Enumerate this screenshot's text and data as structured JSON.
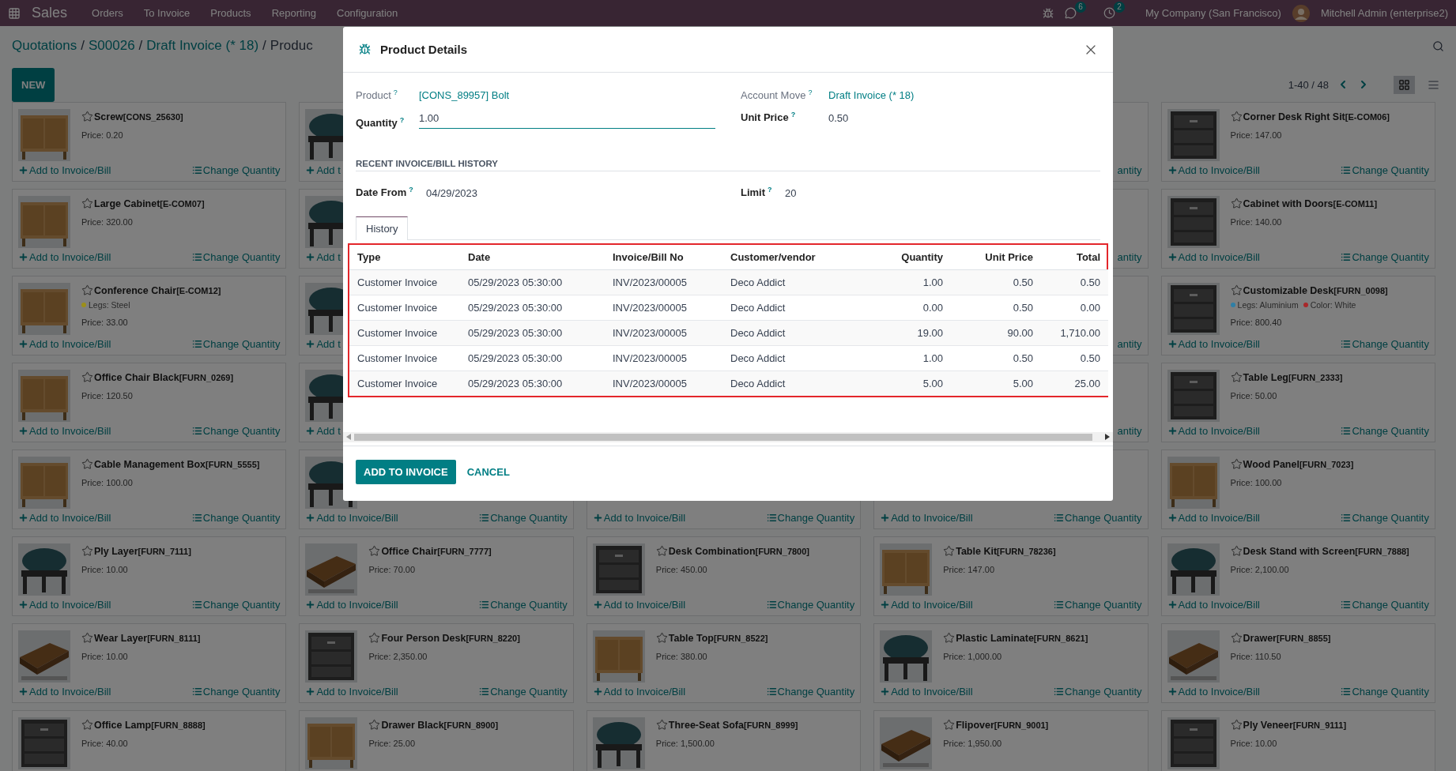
{
  "navbar": {
    "app": "Sales",
    "menu": [
      "Orders",
      "To Invoice",
      "Products",
      "Reporting",
      "Configuration"
    ],
    "messages_badge": "6",
    "activities_badge": "2",
    "company": "My Company (San Francisco)",
    "user": "Mitchell Admin (enterprise2)"
  },
  "breadcrumbs": [
    {
      "kind": "link",
      "text": "Quotations"
    },
    {
      "kind": "separator",
      "text": "/"
    },
    {
      "kind": "link",
      "text": "S00026"
    },
    {
      "kind": "separator",
      "text": "/"
    },
    {
      "kind": "link",
      "text": "Draft Invoice (* 18)"
    },
    {
      "kind": "separator",
      "text": "/"
    },
    {
      "kind": "current",
      "text": "Produc"
    }
  ],
  "new_button": "NEW",
  "pager": "1-40 / 48",
  "views": [
    {
      "kind": "kanban",
      "selected": true
    },
    {
      "kind": "list",
      "selected": false
    }
  ],
  "cards": [
    {
      "name": "Screw",
      "code": "[CONS_25630]",
      "price": "Price: 0.20",
      "image": {
        "kind": "picture"
      },
      "add": "Add to Invoice/Bill",
      "change": "Change Quantity"
    },
    {
      "image": {
        "kind": "picture"
      },
      "add": "Add t"
    },
    {
      "kind": "cut_right",
      "change": "antity"
    },
    {
      "name": "Corner Desk Right Sit",
      "code": "[E-COM06]",
      "price": "Price: 147.00",
      "image": {
        "kind": "picture"
      },
      "add": "Add to Invoice/Bill",
      "change": "Change Quantity"
    },
    {
      "name": "Large Cabinet",
      "code": "[E-COM07]",
      "price": "Price: 320.00",
      "image": {
        "kind": "picture"
      },
      "add": "Add to Invoice/Bill",
      "change": "Change Quantity"
    },
    {
      "image": {
        "kind": "picture"
      },
      "add": "Add t"
    },
    {
      "kind": "cut_right",
      "change": "antity"
    },
    {
      "name": "Cabinet with Doors",
      "code": "[E-COM11]",
      "price": "Price: 140.00",
      "image": {
        "kind": "picture"
      },
      "add": "Add to Invoice/Bill",
      "change": "Change Quantity"
    },
    {
      "name": "Conference Chair",
      "code": "[E-COM12]",
      "attributes": [
        {
          "text": "Legs: Steel",
          "color": "#9c8f1a"
        }
      ],
      "price": "Price: 33.00",
      "image": {
        "kind": "picture"
      },
      "add": "Add to Invoice/Bill",
      "change": "Change Quantity"
    },
    {
      "image": {
        "kind": "picture"
      },
      "add": "Add t"
    },
    {
      "kind": "cut_right",
      "change": "antity"
    },
    {
      "name": "Customizable Desk",
      "code": "[FURN_0098]",
      "attributes": [
        {
          "text": "Legs: Aluminium",
          "color": "#2f7fa6"
        },
        {
          "text": "Color: White",
          "color": "#a8282a"
        }
      ],
      "price": "Price: 800.40",
      "image": {
        "kind": "picture"
      },
      "add": "Add to Invoice/Bill",
      "change": "Change Quantity"
    },
    {
      "name": "Office Chair Black",
      "code": "[FURN_0269]",
      "price": "Price: 120.50",
      "image": {
        "kind": "picture"
      },
      "add": "Add to Invoice/Bill",
      "change": "Change Quantity"
    },
    {
      "image": {
        "kind": "picture"
      },
      "add": "Add t"
    },
    {
      "kind": "cut_right",
      "change": "antity"
    },
    {
      "name": "Table Leg",
      "code": "[FURN_2333]",
      "price": "Price: 50.00",
      "image": {
        "kind": "picture"
      },
      "add": "Add to Invoice/Bill",
      "change": "Change Quantity"
    },
    {
      "name": "Cable Management Box",
      "code": "[FURN_5555]",
      "price": "Price: 100.00",
      "image": {
        "kind": "picture"
      },
      "add": "Add to Invoice/Bill",
      "change": "Change Quantity"
    },
    {
      "image": {
        "kind": "picture"
      },
      "add": "Add to Invoice/Bill",
      "change": "Change Quantity"
    },
    {
      "add": "Add to Invoice/Bill",
      "change": "Change Quantity"
    },
    {
      "add": "Add to Invoice/Bill",
      "change": "Change Quantity"
    },
    {
      "name": "Wood Panel",
      "code": "[FURN_7023]",
      "price": "Price: 100.00",
      "image": {
        "kind": "picture"
      },
      "add": "Add to Invoice/Bill",
      "change": "Change Quantity"
    },
    {
      "name": "Ply Layer",
      "code": "[FURN_7111]",
      "price": "Price: 10.00",
      "image": {
        "kind": "picture"
      },
      "add": "Add to Invoice/Bill",
      "change": "Change Quantity"
    },
    {
      "name": "Office Chair",
      "code": "[FURN_7777]",
      "price": "Price: 70.00",
      "image": {
        "kind": "picture"
      },
      "add": "Add to Invoice/Bill",
      "change": "Change Quantity"
    },
    {
      "name": "Desk Combination",
      "code": "[FURN_7800]",
      "price": "Price: 450.00",
      "image": {
        "kind": "picture"
      },
      "add": "Add to Invoice/Bill",
      "change": "Change Quantity"
    },
    {
      "name": "Table Kit",
      "code": "[FURN_78236]",
      "price": "Price: 147.00",
      "image": {
        "kind": "picture"
      },
      "add": "Add to Invoice/Bill",
      "change": "Change Quantity"
    },
    {
      "name": "Desk Stand with Screen",
      "code": "[FURN_7888]",
      "price": "Price: 2,100.00",
      "image": {
        "kind": "picture"
      },
      "add": "Add to Invoice/Bill",
      "change": "Change Quantity"
    },
    {
      "name": "Wear Layer",
      "code": "[FURN_8111]",
      "price": "Price: 10.00",
      "image": {
        "kind": "picture"
      },
      "add": "Add to Invoice/Bill",
      "change": "Change Quantity"
    },
    {
      "name": "Four Person Desk",
      "code": "[FURN_8220]",
      "price": "Price: 2,350.00",
      "image": {
        "kind": "picture"
      },
      "add": "Add to Invoice/Bill",
      "change": "Change Quantity"
    },
    {
      "name": "Table Top",
      "code": "[FURN_8522]",
      "price": "Price: 380.00",
      "image": {
        "kind": "picture"
      },
      "add": "Add to Invoice/Bill",
      "change": "Change Quantity"
    },
    {
      "name": "Plastic Laminate",
      "code": "[FURN_8621]",
      "price": "Price: 1,000.00",
      "image": {
        "kind": "picture"
      },
      "add": "Add to Invoice/Bill",
      "change": "Change Quantity"
    },
    {
      "name": "Drawer",
      "code": "[FURN_8855]",
      "price": "Price: 110.50",
      "image": {
        "kind": "picture"
      },
      "add": "Add to Invoice/Bill",
      "change": "Change Quantity"
    },
    {
      "name": "Office Lamp",
      "code": "[FURN_8888]",
      "price": "Price: 40.00",
      "image": {
        "kind": "picture"
      }
    },
    {
      "name": "Drawer Black",
      "code": "[FURN_8900]",
      "price": "Price: 25.00",
      "image": {
        "kind": "picture"
      }
    },
    {
      "name": "Three-Seat Sofa",
      "code": "[FURN_8999]",
      "price": "Price: 1,500.00",
      "image": {
        "kind": "picture"
      }
    },
    {
      "name": "Flipover",
      "code": "[FURN_9001]",
      "price": "Price: 1,950.00",
      "image": {
        "kind": "picture"
      }
    },
    {
      "name": "Ply Veneer",
      "code": "[FURN_9111]",
      "price": "Price: 10.00",
      "image": {
        "kind": "picture"
      }
    }
  ],
  "dialog": {
    "title": "Product Details",
    "fields_left": [
      {
        "label": "Product",
        "help": "?",
        "value": "[CONS_89957] Bolt",
        "kind": "link"
      },
      {
        "label": "Quantity",
        "help": "?",
        "value": "1.00",
        "kind": "input"
      }
    ],
    "fields_right": [
      {
        "label": "Account Move",
        "help": "?",
        "value": "Draft Invoice (* 18)",
        "kind": "link"
      },
      {
        "label": "Unit Price",
        "help": "?",
        "value": "0.50",
        "kind": "text"
      }
    ],
    "section": "RECENT INVOICE/BILL HISTORY",
    "filters": [
      {
        "label": "Date From",
        "help": "?",
        "value": "04/29/2023",
        "kind": "text"
      },
      {
        "label": "Limit",
        "help": "?",
        "value": "20",
        "kind": "text"
      }
    ],
    "tabs": [
      {
        "label": "History",
        "selected": true
      }
    ],
    "table": {
      "columns": [
        {
          "label": "Type",
          "kind": "text"
        },
        {
          "label": "Date",
          "kind": "text"
        },
        {
          "label": "Invoice/Bill No",
          "kind": "text"
        },
        {
          "label": "Customer/vendor",
          "kind": "text"
        },
        {
          "label": "Quantity",
          "kind": "number"
        },
        {
          "label": "Unit Price",
          "kind": "number"
        },
        {
          "label": "Total",
          "kind": "number"
        }
      ],
      "rows": [
        [
          "Customer Invoice",
          "05/29/2023 05:30:00",
          "INV/2023/00005",
          "Deco Addict",
          "1.00",
          "0.50",
          "0.50"
        ],
        [
          "Customer Invoice",
          "05/29/2023 05:30:00",
          "INV/2023/00005",
          "Deco Addict",
          "0.00",
          "0.50",
          "0.00"
        ],
        [
          "Customer Invoice",
          "05/29/2023 05:30:00",
          "INV/2023/00005",
          "Deco Addict",
          "19.00",
          "90.00",
          "1,710.00"
        ],
        [
          "Customer Invoice",
          "05/29/2023 05:30:00",
          "INV/2023/00005",
          "Deco Addict",
          "1.00",
          "0.50",
          "0.50"
        ],
        [
          "Customer Invoice",
          "05/29/2023 05:30:00",
          "INV/2023/00005",
          "Deco Addict",
          "5.00",
          "5.00",
          "25.00"
        ]
      ]
    },
    "buttons": [
      {
        "label": "ADD TO INVOICE",
        "kind": "primary"
      },
      {
        "label": "CANCEL",
        "kind": "secondary"
      }
    ]
  }
}
